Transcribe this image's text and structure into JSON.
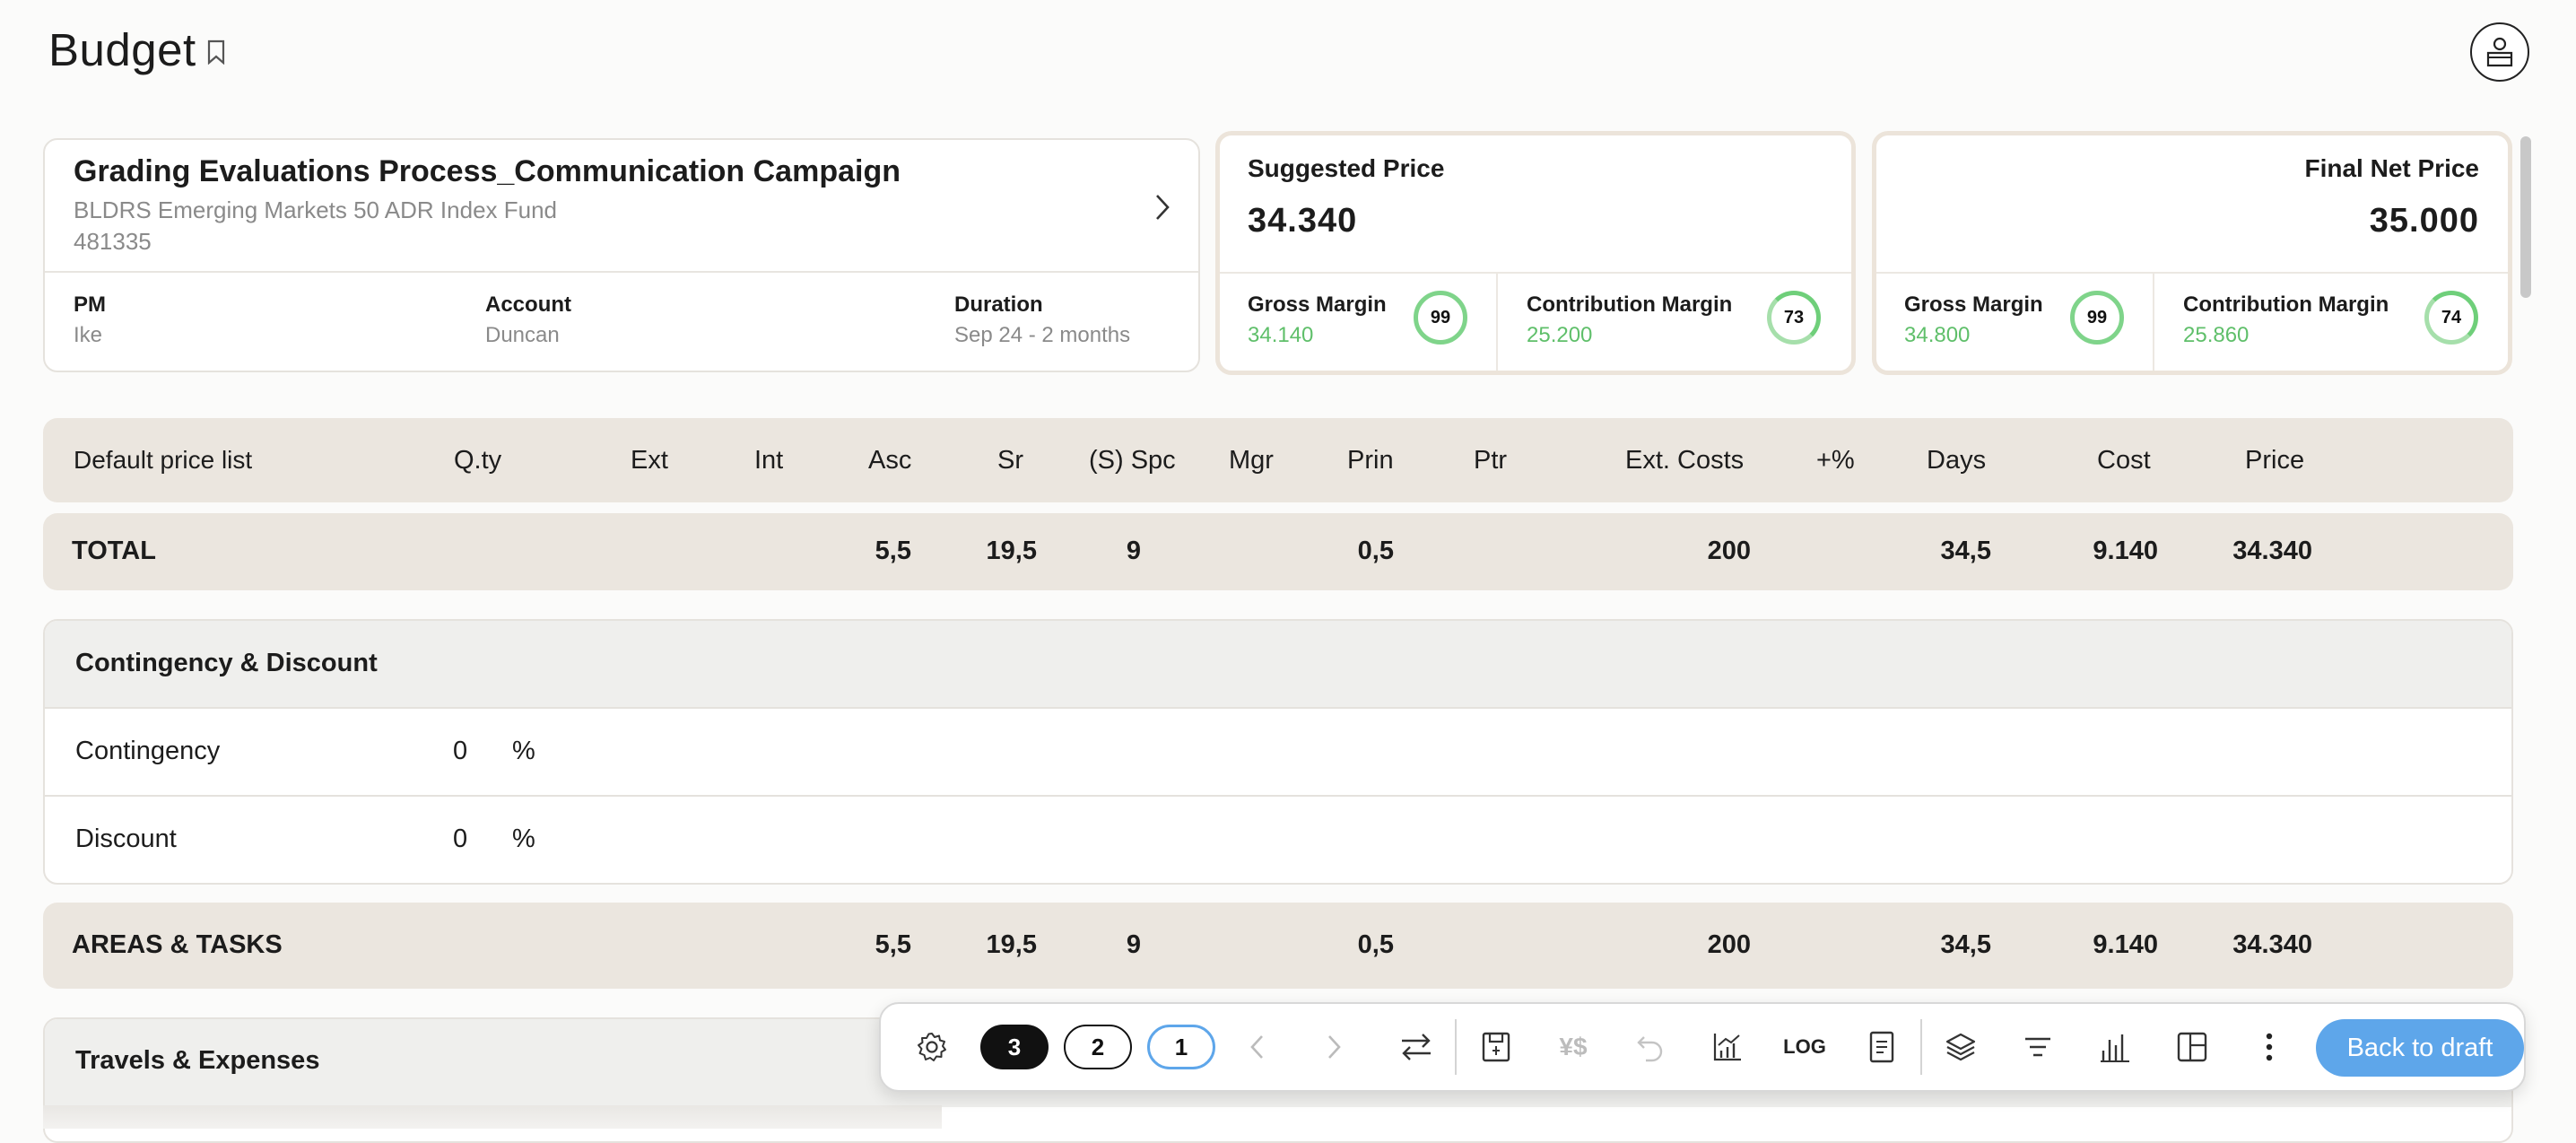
{
  "page": {
    "title": "Budget"
  },
  "project": {
    "title": "Grading Evaluations Process_Communication Campaign",
    "subtitle": "BLDRS Emerging Markets 50 ADR Index Fund",
    "code": "481335",
    "pm_label": "PM",
    "pm_value": "Ike",
    "account_label": "Account",
    "account_value": "Duncan",
    "duration_label": "Duration",
    "duration_value": "Sep 24 - 2 months"
  },
  "suggested": {
    "label": "Suggested Price",
    "value": "34.340",
    "gross_label": "Gross Margin",
    "gross_value": "34.140",
    "gross_pct": "99",
    "contrib_label": "Contribution Margin",
    "contrib_value": "25.200",
    "contrib_pct": "73"
  },
  "final": {
    "label": "Final Net Price",
    "value": "35.000",
    "gross_label": "Gross Margin",
    "gross_value": "34.800",
    "gross_pct": "99",
    "contrib_label": "Contribution Margin",
    "contrib_value": "25.860",
    "contrib_pct": "74"
  },
  "table": {
    "headers": [
      "Default price list",
      "Q.ty",
      "Ext",
      "Int",
      "Asc",
      "Sr",
      "(S) Spc",
      "Mgr",
      "Prin",
      "Ptr",
      "Ext. Costs",
      "+%",
      "Days",
      "Cost",
      "Price"
    ],
    "total": {
      "label": "TOTAL",
      "asc": "5,5",
      "sr": "19,5",
      "spc": "9",
      "prin": "0,5",
      "ext_costs": "200",
      "days": "34,5",
      "cost": "9.140",
      "price": "34.340"
    },
    "contingency_section": {
      "title": "Contingency & Discount",
      "rows": [
        {
          "label": "Contingency",
          "value": "0",
          "unit": "%"
        },
        {
          "label": "Discount",
          "value": "0",
          "unit": "%"
        }
      ]
    },
    "areas": {
      "label": "AREAS & TASKS",
      "asc": "5,5",
      "sr": "19,5",
      "spc": "9",
      "prin": "0,5",
      "ext_costs": "200",
      "days": "34,5",
      "cost": "9.140",
      "price": "34.340"
    },
    "travels_title": "Travels & Expenses"
  },
  "toolbar": {
    "version_3": "3",
    "version_2": "2",
    "version_1": "1",
    "currency_label": "¥$",
    "log_label": "LOG",
    "back_label": "Back to draft",
    "accent": "#5ea6ea"
  }
}
